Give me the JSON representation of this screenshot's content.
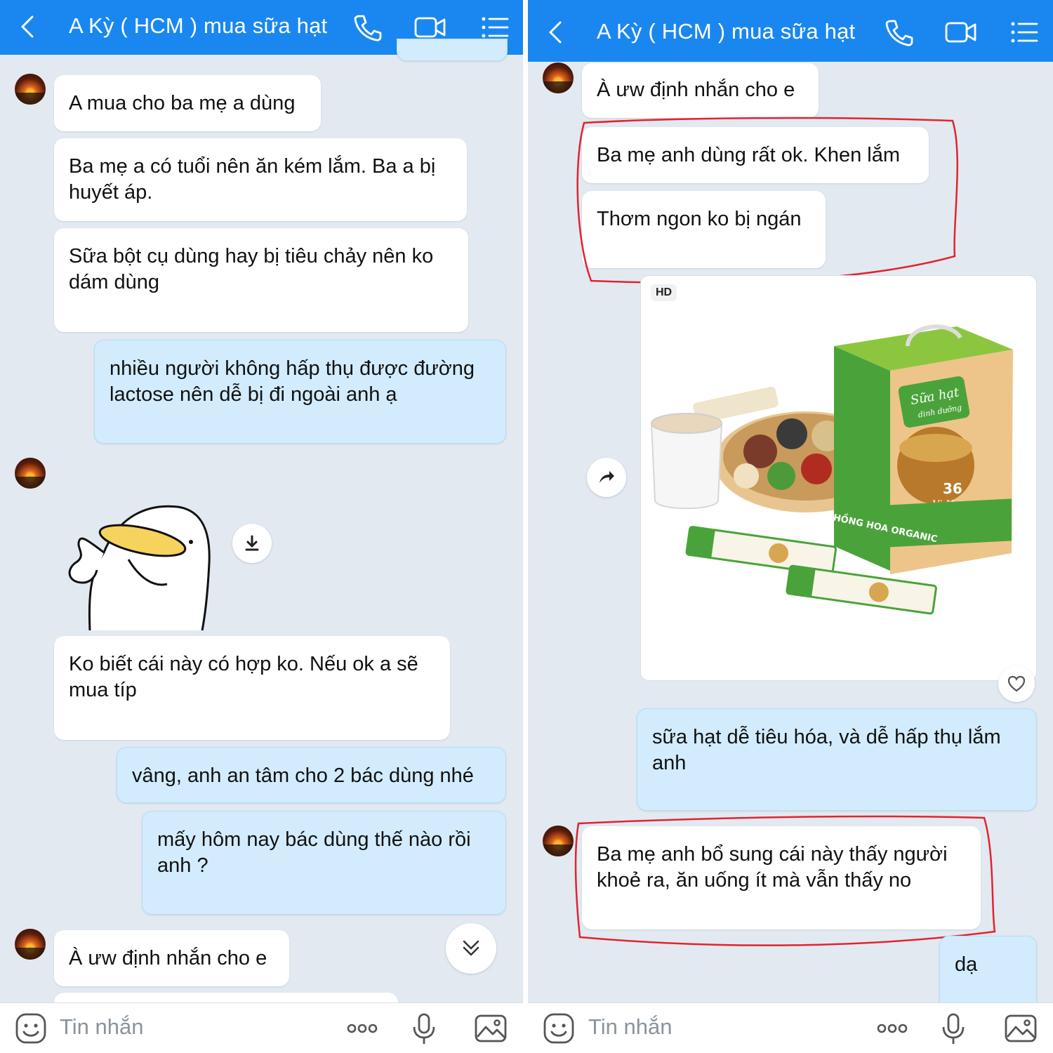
{
  "left_screen": {
    "header": {
      "title": "A Kỳ ( HCM ) mua sữa hạt"
    },
    "messages": [
      {
        "dir": "in",
        "text": "A mua cho ba mẹ a dùng"
      },
      {
        "dir": "in",
        "text": "Ba mẹ a có tuổi nên ăn kém lắm. Ba a bị huyết áp."
      },
      {
        "dir": "in",
        "text": "Sữa bột cụ dùng hay bị tiêu chảy nên ko dám dùng"
      },
      {
        "dir": "out",
        "text": "nhiều người không hấp thụ được đường lactose nên dễ bị đi ngoài anh ạ"
      },
      {
        "dir": "in",
        "text": "Ko biết cái này có hợp ko. Nếu ok a sẽ mua típ"
      },
      {
        "dir": "out",
        "text": "vâng, anh an tâm cho 2 bác dùng nhé"
      },
      {
        "dir": "out",
        "text": "mấy hôm nay bác dùng thế nào rồi anh ?"
      },
      {
        "dir": "in",
        "text": "À ưw định nhắn cho e"
      }
    ],
    "sticker": {
      "kind": "cartoon-duck-thumbs-up"
    },
    "composer": {
      "placeholder": "Tin nhắn"
    }
  },
  "right_screen": {
    "header": {
      "title": "A Kỳ ( HCM ) mua sữa hạt"
    },
    "messages": [
      {
        "dir": "in",
        "text": "À ưw định nhắn cho e"
      },
      {
        "dir": "in",
        "text": "Ba mẹ anh dùng rất ok. Khen lắm",
        "highlighted": true
      },
      {
        "dir": "in",
        "text": "Thơm ngon ko bị ngán",
        "highlighted": true
      },
      {
        "dir": "out",
        "text": "sữa hạt dễ tiêu hóa, và dễ hấp thụ lắm anh"
      },
      {
        "dir": "in",
        "text": "Ba mẹ anh bổ sung cái này thấy người khoẻ ra, ăn uống ít mà vẫn thấy no",
        "highlighted": true
      },
      {
        "dir": "out",
        "text": "dạ"
      }
    ],
    "photo": {
      "badge": "HD",
      "product": {
        "name_line1": "Sữa hạt",
        "name_line2": "dinh dưỡng",
        "count": "36",
        "count_label": "Vị Hạt",
        "brand": "HỒNG HOA ORGANIC"
      }
    },
    "composer": {
      "placeholder": "Tin nhắn"
    }
  },
  "colors": {
    "header_blue": "#1a87f0",
    "chat_background": "#e2e9f1",
    "incoming_bubble": "#ffffff",
    "outgoing_bubble": "#d2ecfd",
    "highlight_red": "#e3232f"
  }
}
